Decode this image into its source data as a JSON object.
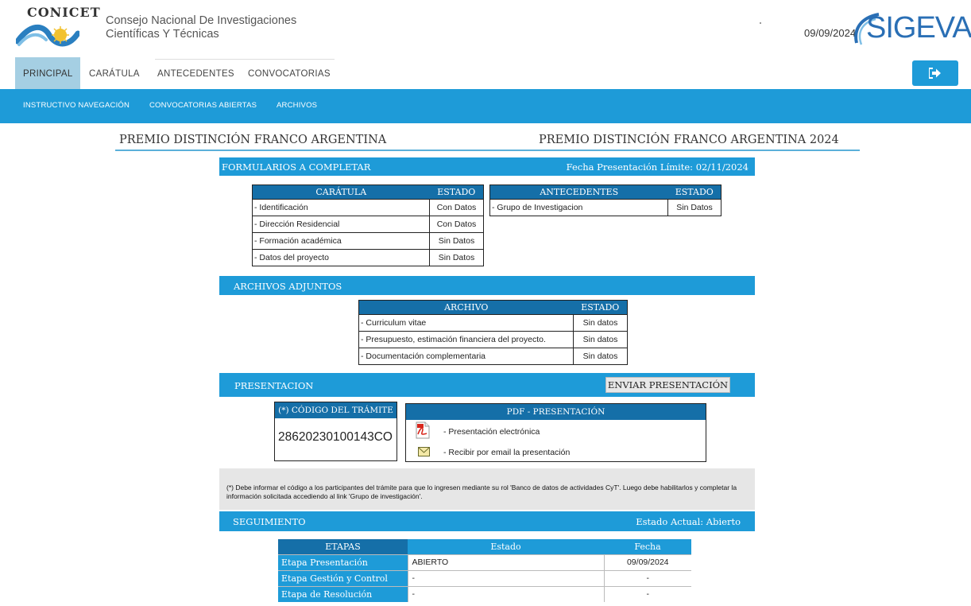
{
  "header": {
    "logo_word": "CONICET",
    "org_line1": "Consejo Nacional De Investigaciones",
    "org_line2": "Científicas Y Técnicas",
    "date": "09/09/2024",
    "app_logo": "SIGEVA"
  },
  "nav": {
    "tabs": [
      {
        "label": "PRINCIPAL"
      },
      {
        "label": "CARÁTULA"
      },
      {
        "label": "ANTECEDENTES"
      },
      {
        "label": "CONVOCATORIAS"
      }
    ],
    "logout_icon": "logout-icon"
  },
  "subnav": {
    "items": [
      {
        "label": "INSTRUCTIVO NAVEGACIÓN"
      },
      {
        "label": "CONVOCATORIAS ABIERTAS"
      },
      {
        "label": "ARCHIVOS"
      }
    ]
  },
  "page": {
    "title_left": "PREMIO DISTINCIÓN FRANCO ARGENTINA",
    "title_right": "PREMIO DISTINCIÓN FRANCO ARGENTINA 2024"
  },
  "formularios": {
    "title": "FORMULARIOS A COMPLETAR",
    "deadline": "Fecha Presentación Límite:  02/11/2024",
    "caratula": {
      "header": "CARÁTULA",
      "status_header": "ESTADO",
      "rows": [
        {
          "name": "- Identificación",
          "status": "Con Datos"
        },
        {
          "name": "- Dirección Residencial",
          "status": "Con Datos"
        },
        {
          "name": "- Formación académica",
          "status": "Sin Datos"
        },
        {
          "name": "- Datos del proyecto",
          "status": "Sin Datos"
        }
      ]
    },
    "antecedentes": {
      "header": "ANTECEDENTES",
      "status_header": "ESTADO",
      "rows": [
        {
          "name": "- Grupo de Investigacion",
          "status": "Sin Datos"
        }
      ]
    }
  },
  "archivos": {
    "title": "ARCHIVOS ADJUNTOS",
    "header": "ARCHIVO",
    "status_header": "ESTADO",
    "rows": [
      {
        "name": "- Curriculum vitae",
        "status": "Sin datos"
      },
      {
        "name": "- Presupuesto, estimación financiera del proyecto.",
        "status": "Sin datos"
      },
      {
        "name": "- Documentación complementaria",
        "status": "Sin datos"
      }
    ]
  },
  "presentacion": {
    "title": "PRESENTACION",
    "send_button": "ENVIAR PRESENTACIÓN",
    "code_header": "(*) CÓDIGO DEL TRÁMITE",
    "code": "28620230100143CO",
    "pdf_header": "PDF - PRESENTACIÓN",
    "pdf_link": "- Presentación electrónica",
    "email_link": "- Recibir por email la presentación",
    "note": "(*) Debe informar el código a los participantes del trámite para que lo ingresen mediante su rol 'Banco de datos de actividades CyT'. Luego debe habilitarlos y completar la información solicitada accediendo al link 'Grupo de investigación'."
  },
  "seguimiento": {
    "title": "SEGUIMIENTO",
    "estado_label": "Estado Actual:  Abierto",
    "headers": [
      "ETAPAS",
      "Estado",
      "Fecha"
    ],
    "rows": [
      {
        "stage": "Etapa Presentación",
        "state": "ABIERTO",
        "date": "09/09/2024"
      },
      {
        "stage": "Etapa Gestión y Control",
        "state": "-",
        "date": "-"
      },
      {
        "stage": "Etapa de Resolución",
        "state": "-",
        "date": "-"
      }
    ]
  },
  "colors": {
    "primary": "#1e9bd8",
    "table_header": "#156fa8",
    "nav_active": "#a5cfe3"
  }
}
